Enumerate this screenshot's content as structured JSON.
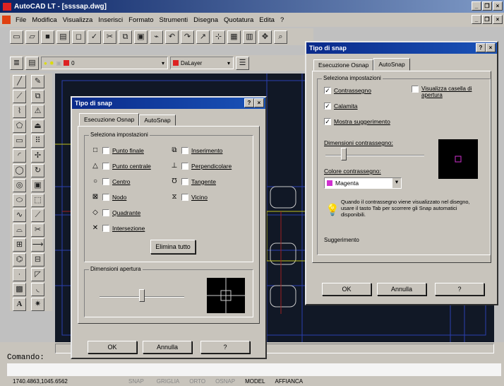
{
  "app": {
    "title": "AutoCAD LT - [ssssap.dwg]"
  },
  "menu": [
    "File",
    "Modifica",
    "Visualizza",
    "Inserisci",
    "Formato",
    "Strumenti",
    "Disegna",
    "Quotatura",
    "Edita",
    "?"
  ],
  "layer": {
    "name": "0",
    "color_label": "DaLayer"
  },
  "command": {
    "label": "Comando:",
    "coords": "1740.4863,1045.6562"
  },
  "status": {
    "buttons": [
      "SNAP",
      "GRIGLIA",
      "ORTO",
      "OSNAP",
      "MODEL",
      "AFFIANCA"
    ]
  },
  "osnap_dialog": {
    "title": "Tipo di snap",
    "tabs": [
      "Esecuzione Osnap",
      "AutoSnap"
    ],
    "group_title": "Seleziona impostazioni",
    "options_left": [
      "Punto finale",
      "Punto centrale",
      "Centro",
      "Nodo",
      "Quadrante",
      "Intersezione"
    ],
    "options_right": [
      "Inserimento",
      "Perpendicolare",
      "Tangente",
      "Vicino"
    ],
    "clear_all": "Elimina tutto",
    "aperture_title": "Dimensioni apertura",
    "ok": "OK",
    "cancel": "Annulla",
    "help": "?"
  },
  "autosnap_dialog": {
    "title": "Tipo di snap",
    "tabs": [
      "Esecuzione Osnap",
      "AutoSnap"
    ],
    "group_title": "Seleziona impostazioni",
    "options": [
      "Contrassegno",
      "Calamita",
      "Mostra suggerimento"
    ],
    "aperture_box": "Visualizza casella di apertura",
    "size_label": "Dimensioni contrassegno:",
    "color_label": "Colore contrassegno:",
    "color_value": "Magenta",
    "tip": "Quando il contrassegno viene visualizzato nel disegno, usare il tasto Tab per scorrere gli Snap automatici disponibili.",
    "tip_caption": "Suggerimento",
    "ok": "OK",
    "cancel": "Annulla",
    "help": "?"
  },
  "colors": {
    "title_bar": "#0a2466",
    "dialog": "#c8c4bc",
    "drawing_bg": "#111826",
    "marker": "#d030d0"
  }
}
